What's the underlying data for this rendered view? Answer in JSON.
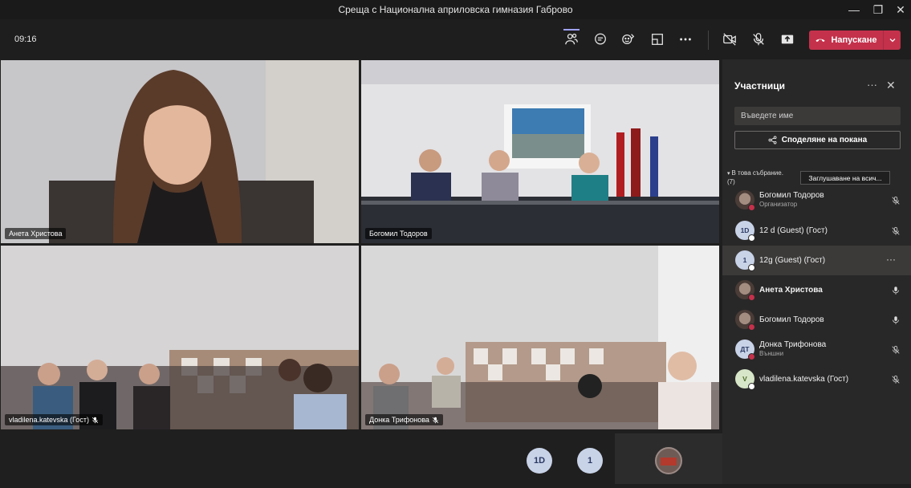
{
  "window": {
    "title": "Среща с Национална априловска гимназия Габрово",
    "minimize": "—",
    "maximize": "❐",
    "close": "✕"
  },
  "toolbar": {
    "time": "09:16",
    "leave_label": "Напускане",
    "accent": "#c4314b",
    "icons": [
      "people-icon",
      "chat-icon",
      "reactions-icon",
      "room-icon",
      "more-icon",
      "camera-off-icon",
      "mic-off-icon",
      "share-tray-icon"
    ]
  },
  "videos": [
    {
      "name": "Анета Христова"
    },
    {
      "name": "Богомил Тодоров"
    },
    {
      "name": "vladilena.katevska (Гост)",
      "muted": true
    },
    {
      "name": "Донка Трифонова",
      "muted": true
    }
  ],
  "bottom": {
    "avatars": [
      "1D",
      "1"
    ]
  },
  "panel": {
    "title": "Участници",
    "search_placeholder": "Въведете име",
    "share_label": "Споделяне на покана",
    "section_label": "В това събрание.",
    "section_count": "(7)",
    "mute_all_label": "Заглушаване на всич...",
    "participants": [
      {
        "name": "Богомил Тодоров",
        "role": "Организатор",
        "avatar": "",
        "status": "#c4314b",
        "mic": "muted"
      },
      {
        "name": "12 d (Guest) (Гост)",
        "role": "",
        "avatar": "1D",
        "status": "#ffffff",
        "mic": "muted"
      },
      {
        "name": "12g (Guest) (Гост)",
        "role": "",
        "avatar": "1",
        "status": "#ffffff",
        "mic": "more",
        "selected": true
      },
      {
        "name": "Анета Христова",
        "role": "",
        "avatar": "",
        "status": "#c4314b",
        "mic": "on",
        "bold": true
      },
      {
        "name": "Богомил Тодоров",
        "role": "",
        "avatar": "",
        "status": "#c4314b",
        "mic": "on"
      },
      {
        "name": "Донка Трифонова",
        "role": "Външни",
        "avatar": "ДТ",
        "status": "#c4314b",
        "mic": "muted"
      },
      {
        "name": "vladilena.katevska (Гост)",
        "role": "",
        "avatar": "V",
        "status": "#ffffff",
        "mic": "muted"
      }
    ]
  }
}
